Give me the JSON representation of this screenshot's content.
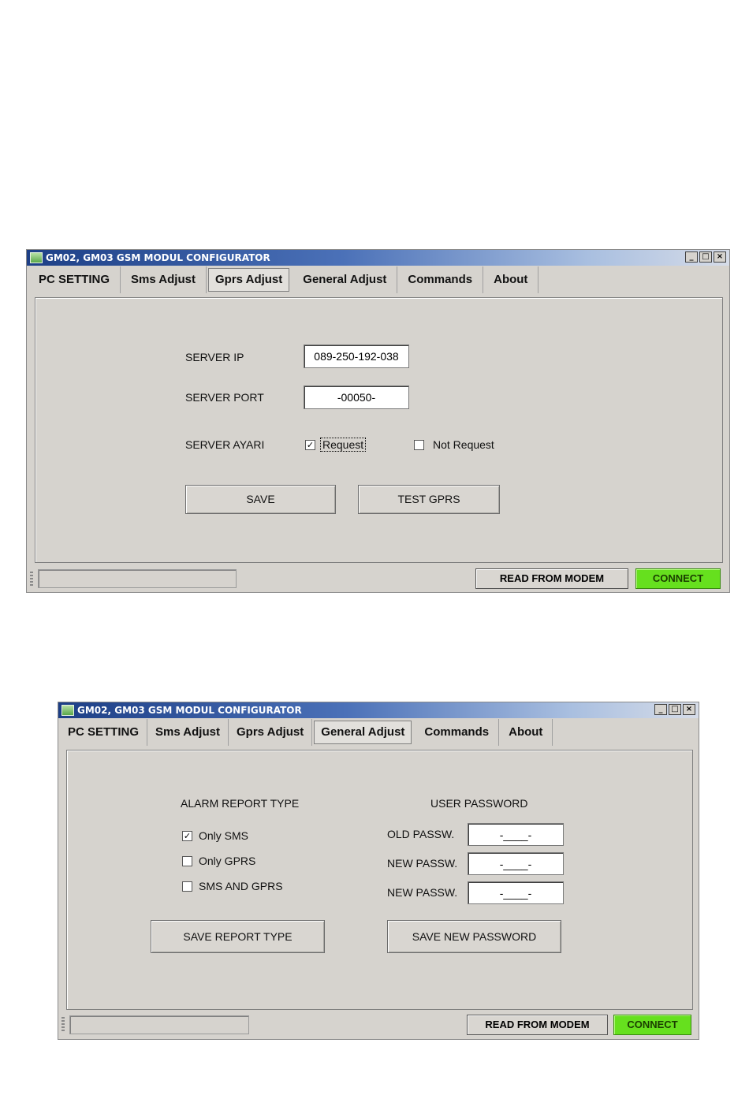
{
  "window_title": "GM02, GM03 GSM MODUL CONFIGURATOR",
  "window_buttons": {
    "minimize": "_",
    "maximize": "□",
    "close": "×"
  },
  "window1": {
    "tabs": [
      {
        "label": "PC SETTING",
        "active": false
      },
      {
        "label": "Sms Adjust",
        "active": false
      },
      {
        "label": "Gprs Adjust",
        "active": true
      },
      {
        "label": "General Adjust",
        "active": false
      },
      {
        "label": "Commands",
        "active": false
      },
      {
        "label": "About",
        "active": false
      }
    ],
    "server_ip_label": "SERVER IP",
    "server_ip_value": "089-250-192-038",
    "server_port_label": "SERVER PORT",
    "server_port_value": "-00050-",
    "server_ayari_label": "SERVER AYARI",
    "request_label": "Request",
    "request_checked": true,
    "not_request_label": "Not Request",
    "not_request_checked": false,
    "save_label": "SAVE",
    "test_gprs_label": "TEST GPRS",
    "read_from_modem_label": "READ FROM MODEM",
    "connect_label": "CONNECT"
  },
  "window2": {
    "tabs": [
      {
        "label": "PC SETTING",
        "active": false
      },
      {
        "label": "Sms Adjust",
        "active": false
      },
      {
        "label": "Gprs Adjust",
        "active": false
      },
      {
        "label": "General Adjust",
        "active": true
      },
      {
        "label": "Commands",
        "active": false
      },
      {
        "label": "About",
        "active": false
      }
    ],
    "alarm_report_type_label": "ALARM REPORT TYPE",
    "only_sms_label": "Only SMS",
    "only_sms_checked": true,
    "only_gprs_label": "Only GPRS",
    "only_gprs_checked": false,
    "sms_and_gprs_label": "SMS AND GPRS",
    "sms_and_gprs_checked": false,
    "user_password_label": "USER PASSWORD",
    "old_passw_label": "OLD PASSW.",
    "old_passw_value": "-____-",
    "new_passw_label": "NEW PASSW.",
    "new_passw_value": "-____-",
    "new_passw2_label": "NEW PASSW.",
    "new_passw2_value": "-____-",
    "save_report_type_label": "SAVE REPORT TYPE",
    "save_new_password_label": "SAVE NEW PASSWORD",
    "read_from_modem_label": "READ FROM MODEM",
    "connect_label": "CONNECT"
  }
}
